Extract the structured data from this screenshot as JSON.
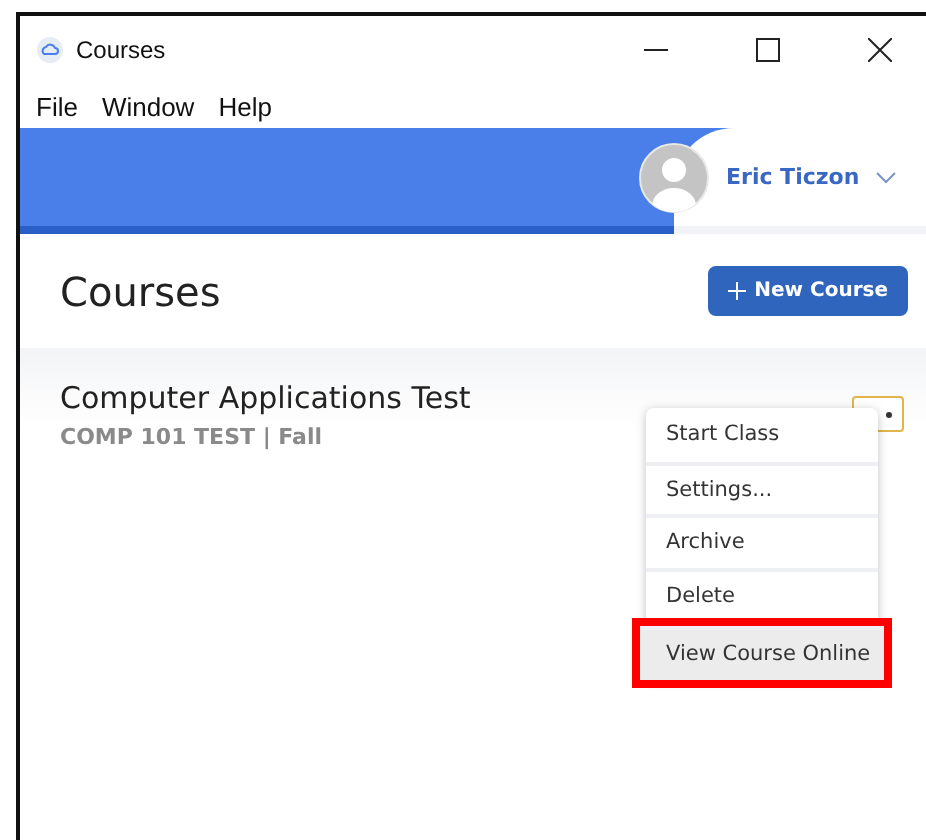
{
  "window": {
    "title": "Courses"
  },
  "menu_bar": [
    {
      "label": "File"
    },
    {
      "label": "Window"
    },
    {
      "label": "Help"
    }
  ],
  "user": {
    "name": "Eric Ticzon"
  },
  "page": {
    "title": "Courses",
    "new_course_button": "New Course"
  },
  "courses": [
    {
      "title": "Computer Applications Test",
      "subtitle": "COMP 101 TEST | Fall",
      "menu_open": true
    }
  ],
  "context_menu": [
    {
      "label": "Start Class",
      "highlighted": false
    },
    {
      "label": "Settings...",
      "highlighted": false
    },
    {
      "label": "Archive",
      "highlighted": false
    },
    {
      "label": "Delete",
      "highlighted": false
    },
    {
      "label": "View Course Online",
      "highlighted": true
    }
  ]
}
